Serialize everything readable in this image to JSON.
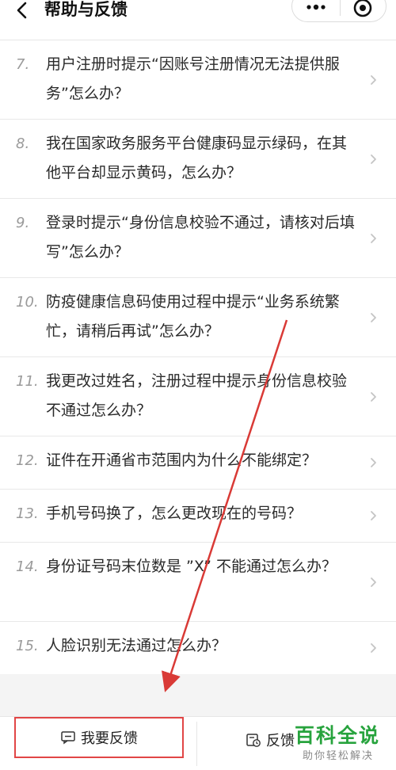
{
  "header": {
    "title": "帮助与反馈",
    "back_icon": "chevron-left-icon",
    "more_icon": "more-dots-icon",
    "close_icon": "target-circle-icon"
  },
  "faq": {
    "items": [
      {
        "num": "7.",
        "text": "用户注册时提示“因账号注册情况无法提供服务”怎么办？"
      },
      {
        "num": "8.",
        "text": "我在国家政务服务平台健康码显示绿码，在其他平台却显示黄码，怎么办？"
      },
      {
        "num": "9.",
        "text": "登录时提示“身份信息校验不通过，请核对后填写”怎么办？"
      },
      {
        "num": "10.",
        "text": "防疫健康信息码使用过程中提示“业务系统繁忙，请稍后再试”怎么办？"
      },
      {
        "num": "11.",
        "text": "我更改过姓名，注册过程中提示身份信息校验不通过怎么办？"
      },
      {
        "num": "12.",
        "text": "证件在开通省市范围内为什么不能绑定？"
      },
      {
        "num": "13.",
        "text": "手机号码换了，怎么更改现在的号码？"
      },
      {
        "num": "14.",
        "text": "身份证号码末位数是 ”X” 不能通过怎么办？"
      },
      {
        "num": "15.",
        "text": "人脸识别无法通过怎么办？"
      }
    ]
  },
  "bottom": {
    "feedback_label": "我要反馈",
    "records_label": "反馈"
  },
  "watermark": {
    "title": "百科全说",
    "subtitle": "助你轻松解决"
  },
  "colors": {
    "highlight_border": "#e14646",
    "annotation_arrow": "#d93a36",
    "watermark_green": "#27a33d"
  }
}
